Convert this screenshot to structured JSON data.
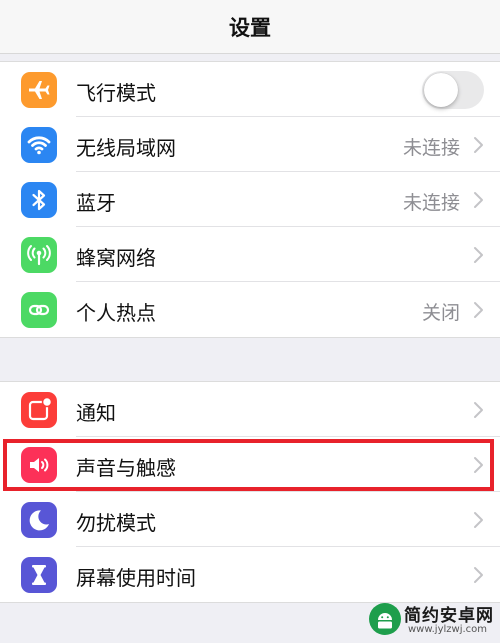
{
  "nav": {
    "title": "设置"
  },
  "group1": {
    "items": [
      {
        "label": "飞行模式",
        "icon": "airplane-icon",
        "icon_color": "#fd9a2d",
        "toggle_on": false
      },
      {
        "label": "无线局域网",
        "icon": "wifi-icon",
        "icon_color": "#2b86f2",
        "value": "未连接"
      },
      {
        "label": "蓝牙",
        "icon": "bluetooth-icon",
        "icon_color": "#2b86f2",
        "value": "未连接"
      },
      {
        "label": "蜂窝网络",
        "icon": "cellular-antenna-icon",
        "icon_color": "#4cd964"
      },
      {
        "label": "个人热点",
        "icon": "personal-hotspot-icon",
        "icon_color": "#4cd964",
        "value": "关闭"
      }
    ]
  },
  "group2": {
    "items": [
      {
        "label": "通知",
        "icon": "notifications-icon",
        "icon_color": "#fc3d39"
      },
      {
        "label": "声音与触感",
        "icon": "speaker-icon",
        "icon_color": "#fc3158"
      },
      {
        "label": "勿扰模式",
        "icon": "moon-icon",
        "icon_color": "#5856d6"
      },
      {
        "label": "屏幕使用时间",
        "icon": "hourglass-icon",
        "icon_color": "#5856d6"
      }
    ]
  },
  "highlight": {
    "color": "#e8222b",
    "target": "声音与触感"
  },
  "watermark": {
    "title": "简约安卓网",
    "url": "www.jylzwj.com"
  }
}
